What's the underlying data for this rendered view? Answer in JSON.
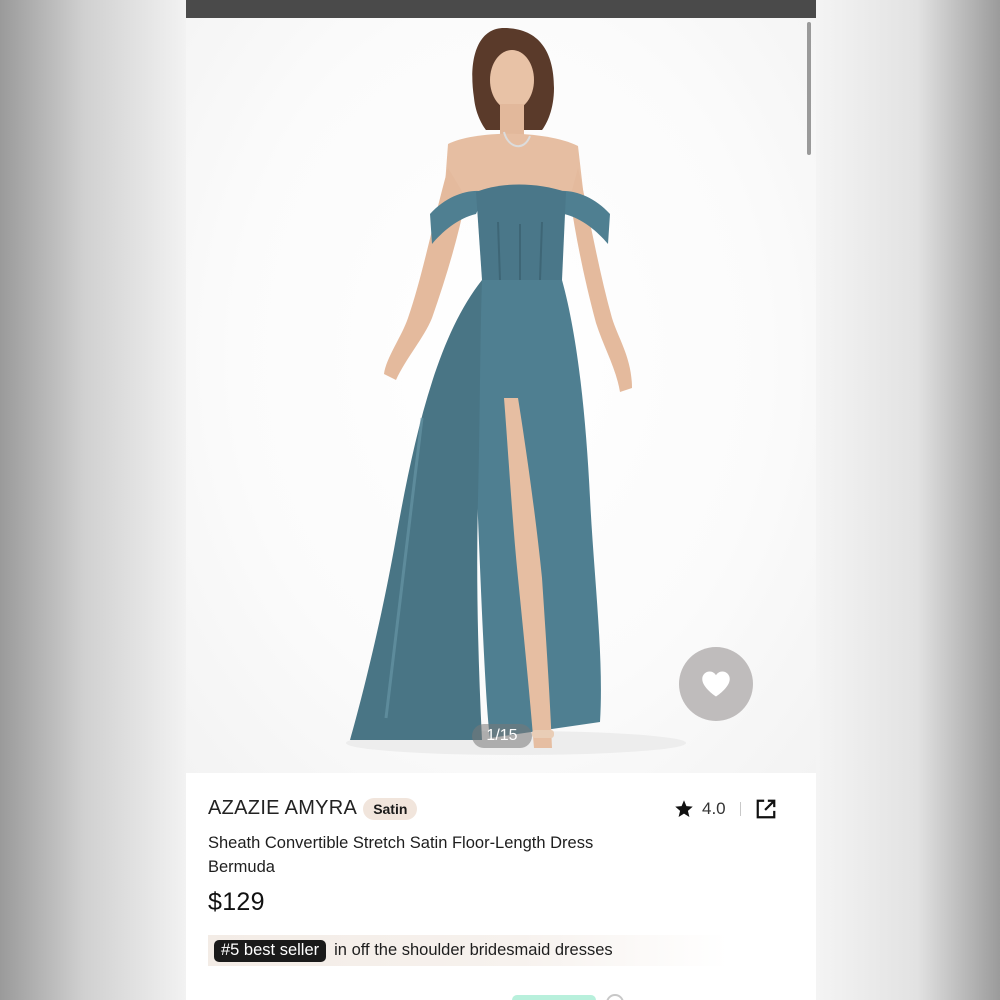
{
  "product": {
    "brand": "AZAZIE AMYRA",
    "fabric_tag": "Satin",
    "title_line1": "Sheath Convertible Stretch Satin Floor-Length Dress",
    "title_line2": "Bermuda",
    "price": "$129",
    "rating": "4.0",
    "image_counter": "1/15",
    "dress_color": "#4f7f91"
  },
  "bestseller": {
    "badge": "#5 best seller",
    "text": "in off the shoulder bridesmaid dresses"
  },
  "icons": {
    "star": "star-icon",
    "share": "external-link-icon",
    "favorite": "heart-icon"
  },
  "colors": {
    "accent_chip": "#f1e5dc",
    "badge_bg": "#1a1a1a"
  }
}
